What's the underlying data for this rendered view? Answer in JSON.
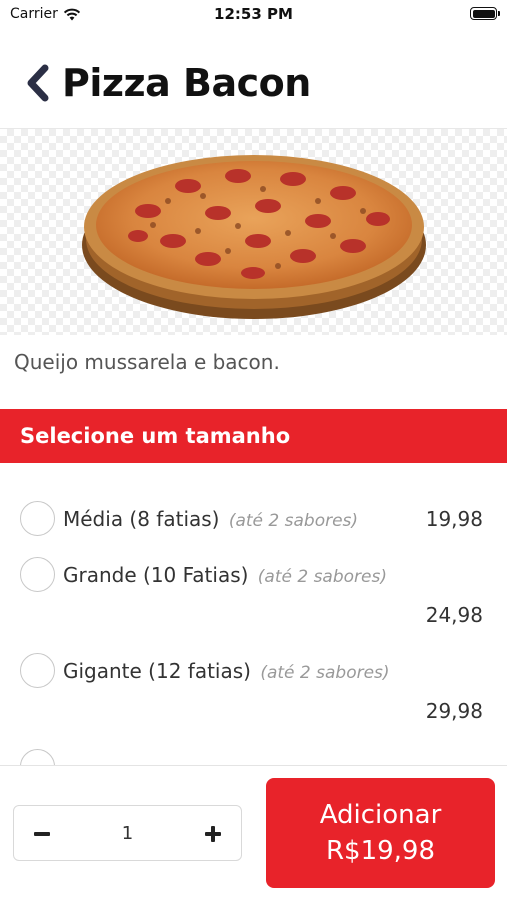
{
  "status_bar": {
    "carrier": "Carrier",
    "time": "12:53 PM"
  },
  "header": {
    "title": "Pizza Bacon"
  },
  "product": {
    "description": "Queijo mussarela e bacon."
  },
  "section": {
    "title": "Selecione um tamanho"
  },
  "sizes": [
    {
      "label": "Média (8 fatias)",
      "note": "(até 2 sabores)",
      "price": "19,98"
    },
    {
      "label": "Grande (10 Fatias)",
      "note": "(até 2 sabores)",
      "price": "24,98"
    },
    {
      "label": "Gigante (12 fatias)",
      "note": "(até 2 sabores)",
      "price": "29,98"
    }
  ],
  "quantity": {
    "value": "1"
  },
  "add_button": {
    "label": "Adicionar",
    "price": "R$19,98"
  },
  "colors": {
    "accent": "#e8232a",
    "text": "#111111",
    "muted": "#999999"
  },
  "icons": {
    "back": "chevron-left-icon",
    "minus": "minus-icon",
    "plus": "plus-icon"
  }
}
